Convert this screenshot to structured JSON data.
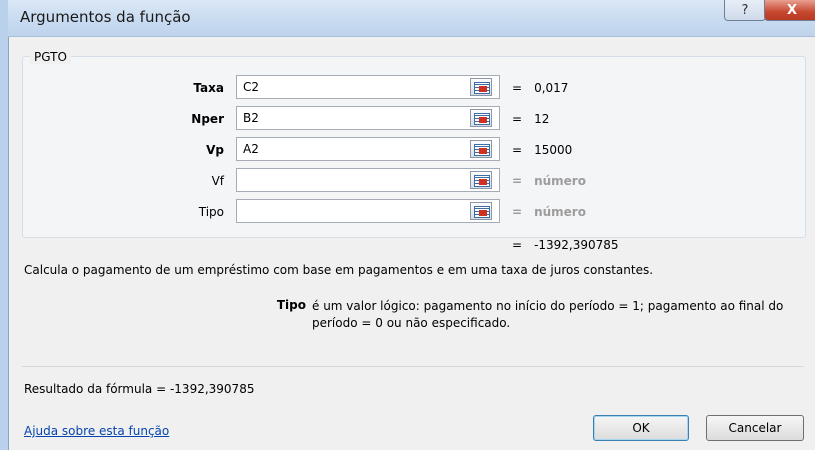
{
  "window": {
    "title": "Argumentos da função",
    "help_glyph": "?",
    "close_glyph": "X"
  },
  "function_name": "PGTO",
  "args": [
    {
      "label": "Taxa",
      "bold": true,
      "value": "C2",
      "equals": "=",
      "result": "0,017"
    },
    {
      "label": "Nper",
      "bold": true,
      "value": "B2",
      "equals": "=",
      "result": "12"
    },
    {
      "label": "Vp",
      "bold": true,
      "value": "A2",
      "equals": "=",
      "result": "15000"
    },
    {
      "label": "Vf",
      "bold": false,
      "value": "",
      "equals": "=",
      "result": "número"
    },
    {
      "label": "Tipo",
      "bold": false,
      "value": "",
      "equals": "=",
      "result": "número"
    }
  ],
  "overall_result": {
    "equals": "=",
    "value": "-1392,390785"
  },
  "description": "Calcula o pagamento de um empréstimo com base em pagamentos e em uma taxa de juros constantes.",
  "argument_help": {
    "name": "Tipo",
    "text": "é um valor lógico: pagamento no início do período = 1; pagamento ao final do período = 0 ou não especificado."
  },
  "formula_result": {
    "label": "Resultado da fórmula =",
    "value": "-1392,390785"
  },
  "help_link": "Ajuda sobre esta função",
  "buttons": {
    "ok": "OK",
    "cancel": "Cancelar"
  }
}
